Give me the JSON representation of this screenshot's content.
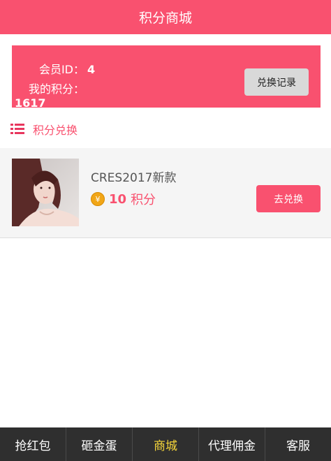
{
  "header": {
    "title": "积分商城"
  },
  "member": {
    "id_label": "会员ID：",
    "id_value": "4",
    "points_label": "我的积分：",
    "points_value": "1617",
    "record_button": "兑换记录"
  },
  "section": {
    "title": "积分兑换"
  },
  "products": [
    {
      "name": "CRES2017新款",
      "price": "10",
      "unit": "积分",
      "button": "去兑换"
    }
  ],
  "nav": {
    "items": [
      "抢红包",
      "砸金蛋",
      "商城",
      "代理佣金",
      "客服"
    ],
    "active": "商城"
  },
  "colors": {
    "brand": "#f9516f",
    "active_nav": "#f5d53a",
    "nav_bg": "#2f2f2f"
  }
}
